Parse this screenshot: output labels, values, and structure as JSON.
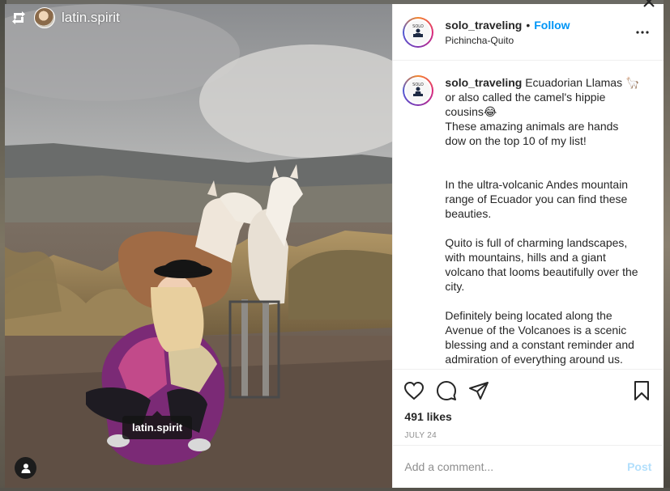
{
  "photo": {
    "repost_icon": "repost-icon",
    "repost_username": "latin.spirit",
    "tag_label": "latin.spirit",
    "user_tag_icon": "user-icon"
  },
  "header": {
    "username": "solo_traveling",
    "separator": "•",
    "follow_label": "Follow",
    "location": "Pichincha-Quito",
    "more_icon": "more-options-icon"
  },
  "caption": {
    "username": "solo_traveling",
    "line1": "Ecuadorian Llamas 🦙 or also called the camel's hippie cousins😂",
    "line2": "These amazing animals are hands dow on the top 10 of my list!",
    "para1": "In the ultra-volcanic Andes mountain range of Ecuador you can find these beauties.",
    "para2": "Quito is full of charming landscapes, with mountains, hills and a giant volcano that looms beautifully over the city.",
    "para3": "Definitely being located along the Avenue of the Volcanoes is a scenic blessing and a constant reminder and admiration of everything around us."
  },
  "actions": {
    "like_icon": "heart-icon",
    "comment_icon": "comment-icon",
    "share_icon": "share-icon",
    "save_icon": "bookmark-icon",
    "likes": "491 likes",
    "date": "JULY 24"
  },
  "comment": {
    "placeholder": "Add a comment...",
    "post_label": "Post"
  },
  "colors": {
    "follow": "#0095f6",
    "post_disabled": "#b2dffc",
    "muted": "#8e8e8e",
    "text": "#262626"
  }
}
